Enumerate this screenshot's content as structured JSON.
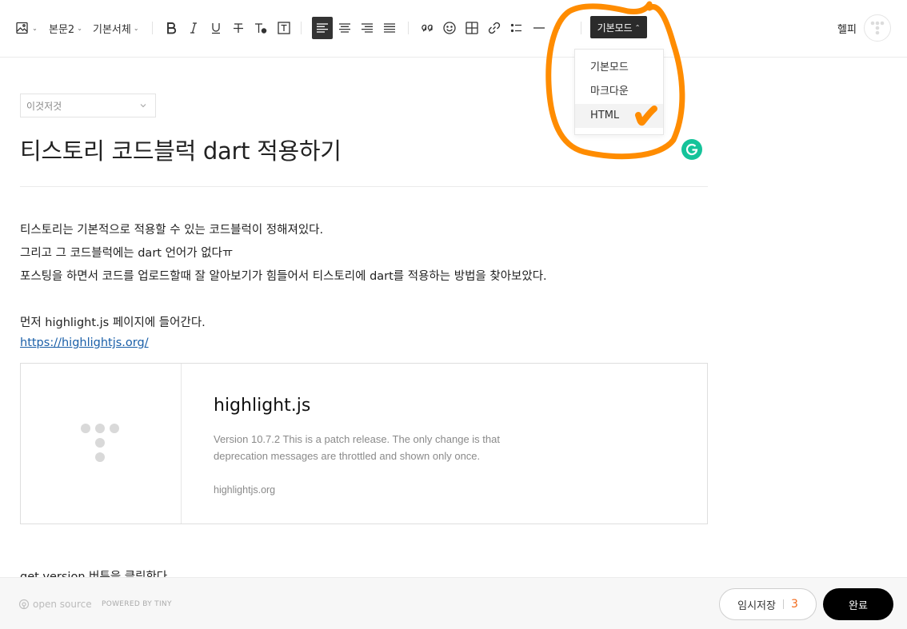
{
  "toolbar": {
    "paragraph_style": "본문2",
    "font_family": "기본서체",
    "mode_button": "기본모드"
  },
  "user": {
    "name": "헬피"
  },
  "mode_menu": {
    "items": [
      "기본모드",
      "마크다운",
      "HTML"
    ],
    "selected": "HTML"
  },
  "post": {
    "category_placeholder": "이것저것",
    "title": "티스토리 코드블럭 dart 적용하기",
    "paragraphs": [
      "티스토리는 기본적으로 적용할 수 있는 코드블럭이 정해져있다.",
      "그리고 그 코드블럭에는 dart 언어가 없다ㅠ",
      "포스팅을 하면서 코드를 업로드할때 잘 알아보기가 힘들어서 티스토리에 dart를 적용하는 방법을 찾아보았다.",
      "먼저 highlight.js 페이지에 들어간다."
    ],
    "link": "https://highlightjs.org/",
    "after_card": "get version 버튼을 클릭한다."
  },
  "og_card": {
    "title": "highlight.js",
    "description": "Version 10.7.2 This is a patch release. The only change is that deprecation messages are throttled and shown only once.",
    "host": "highlightjs.org"
  },
  "footer": {
    "logo_text": "open source",
    "powered": "POWERED BY TINY",
    "save_label": "임시저장",
    "save_count": "3",
    "done_label": "완료"
  },
  "colors": {
    "annotation": "#ff8c00",
    "grammarly": "#15c39a",
    "link": "#1a5fa8",
    "save_count": "#f26a1b"
  }
}
